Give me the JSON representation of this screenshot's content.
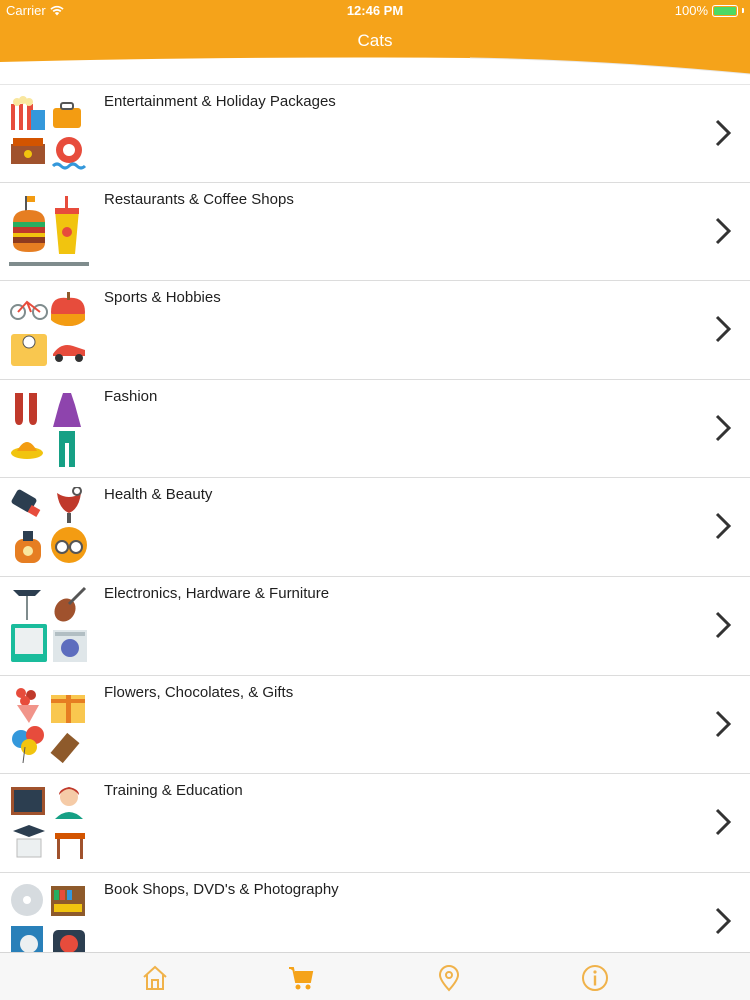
{
  "status_bar": {
    "carrier": "Carrier",
    "time": "12:46 PM",
    "battery": "100%",
    "battery_level": 1.0
  },
  "nav": {
    "title": "Cats",
    "accent_color": "#f5a31a"
  },
  "categories": [
    {
      "label": "Entertainment & Holiday Packages",
      "icon": "entertainment-icon"
    },
    {
      "label": "Restaurants & Coffee Shops",
      "icon": "restaurant-icon"
    },
    {
      "label": "Sports & Hobbies",
      "icon": "sports-icon"
    },
    {
      "label": "Fashion",
      "icon": "fashion-icon"
    },
    {
      "label": "Health & Beauty",
      "icon": "health-beauty-icon"
    },
    {
      "label": "Electronics, Hardware & Furniture",
      "icon": "electronics-icon"
    },
    {
      "label": "Flowers, Chocolates, & Gifts",
      "icon": "gifts-icon"
    },
    {
      "label": "Training & Education",
      "icon": "education-icon"
    },
    {
      "label": "Book Shops, DVD's & Photography",
      "icon": "books-icon"
    }
  ],
  "tabbar": {
    "tabs": [
      {
        "icon": "home-icon"
      },
      {
        "icon": "cart-icon",
        "selected": true
      },
      {
        "icon": "location-pin-icon"
      },
      {
        "icon": "info-icon"
      }
    ],
    "tint_color": "#f0b24a"
  }
}
